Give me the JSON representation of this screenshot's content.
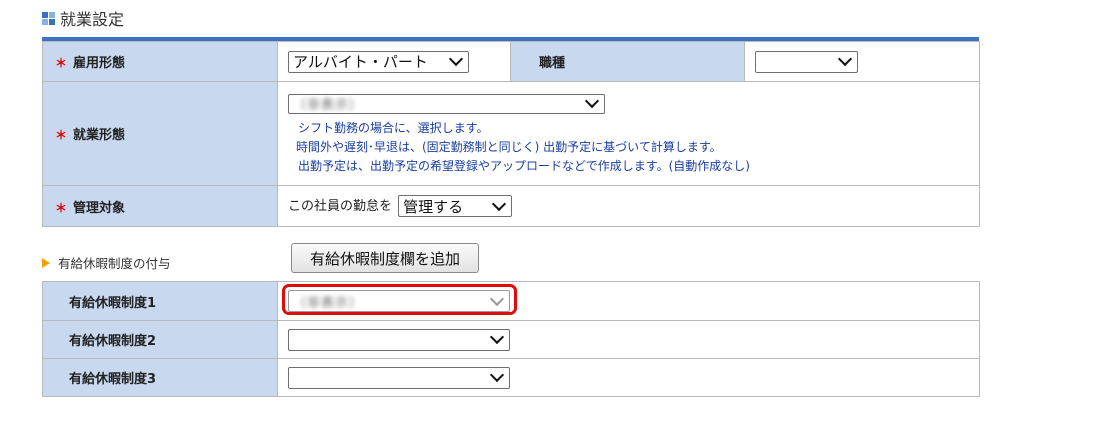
{
  "section_title": "就業設定",
  "employment": {
    "employment_type_label": "雇用形態",
    "employment_type_value": "アルバイト・パート",
    "job_type_label": "職種",
    "job_type_value": "",
    "work_style_label": "就業形態",
    "work_style_value": "（非表示）",
    "work_style_notes": [
      "シフト勤務の場合に、選択します。",
      "時間外や遅刻･早退は、(固定勤務制と同じく) 出勤予定に基づいて計算します。",
      "出勤予定は、出勤予定の希望登録やアップロードなどで作成します。(自動作成なし)"
    ],
    "management_label": "管理対象",
    "management_prefix": "この社員の勤怠を",
    "management_value": "管理する"
  },
  "paid_leave": {
    "header": "有給休暇制度の付与",
    "add_button": "有給休暇制度欄を追加",
    "rows": [
      {
        "label": "有給休暇制度1",
        "value": "（非表示）"
      },
      {
        "label": "有給休暇制度2",
        "value": ""
      },
      {
        "label": "有給休暇制度3",
        "value": ""
      }
    ]
  },
  "colors": {
    "accent_bar": "#3b72c6",
    "label_bg": "#c8d8ee",
    "required_mark": "#e00000",
    "note_text": "#1a3fa0",
    "highlight_box": "#e00b0b"
  }
}
